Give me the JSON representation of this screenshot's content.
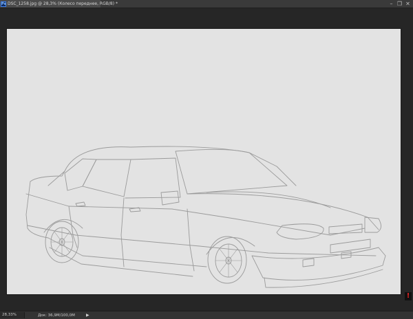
{
  "window": {
    "tab_title": "DSC_1258.jpg @ 28,3% (Колесо переднее, RGB/8) *",
    "app_icon_label": "Ps",
    "controls": {
      "minimize": "–",
      "restore": "❐",
      "close": "✕"
    }
  },
  "status": {
    "zoom": "28,33%",
    "doc_info": "Док: 36,9M/100,0M",
    "arrow": "▶"
  },
  "warning_icon": "!",
  "colors": {
    "workspace_bg": "#262626",
    "canvas_bg": "#e3e3e3",
    "line_art": "#9a9a9a",
    "warning": "#e02424"
  }
}
